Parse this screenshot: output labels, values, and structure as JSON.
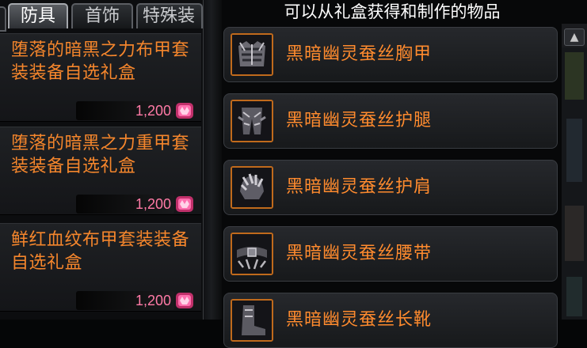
{
  "left_panel": {
    "tabs": [
      {
        "label": "防具",
        "active": true
      },
      {
        "label": "首饰",
        "active": false
      },
      {
        "label": "特殊装",
        "active": false
      }
    ],
    "items": [
      {
        "name": "堕落的暗黑之力布甲套装装备自选礼盒",
        "price": "1,200"
      },
      {
        "name": "堕落的暗黑之力重甲套装装备自选礼盒",
        "price": "1,200"
      },
      {
        "name": "鲜红血纹布甲套装装备自选礼盒",
        "price": "1,200"
      }
    ],
    "currency_icon": "gem-coin-icon"
  },
  "right_panel": {
    "title": "可以从礼盒获得和制作的物品",
    "items": [
      {
        "name": "黑暗幽灵蚕丝胸甲",
        "icon": "chest-armor-icon"
      },
      {
        "name": "黑暗幽灵蚕丝护腿",
        "icon": "leg-armor-icon"
      },
      {
        "name": "黑暗幽灵蚕丝护肩",
        "icon": "shoulder-armor-icon"
      },
      {
        "name": "黑暗幽灵蚕丝腰带",
        "icon": "belt-icon"
      },
      {
        "name": "黑暗幽灵蚕丝长靴",
        "icon": "boots-icon"
      }
    ]
  },
  "colors": {
    "item_name": "#ff8b2e",
    "price": "#ff7aa6",
    "icon_border": "#c06a1c"
  }
}
